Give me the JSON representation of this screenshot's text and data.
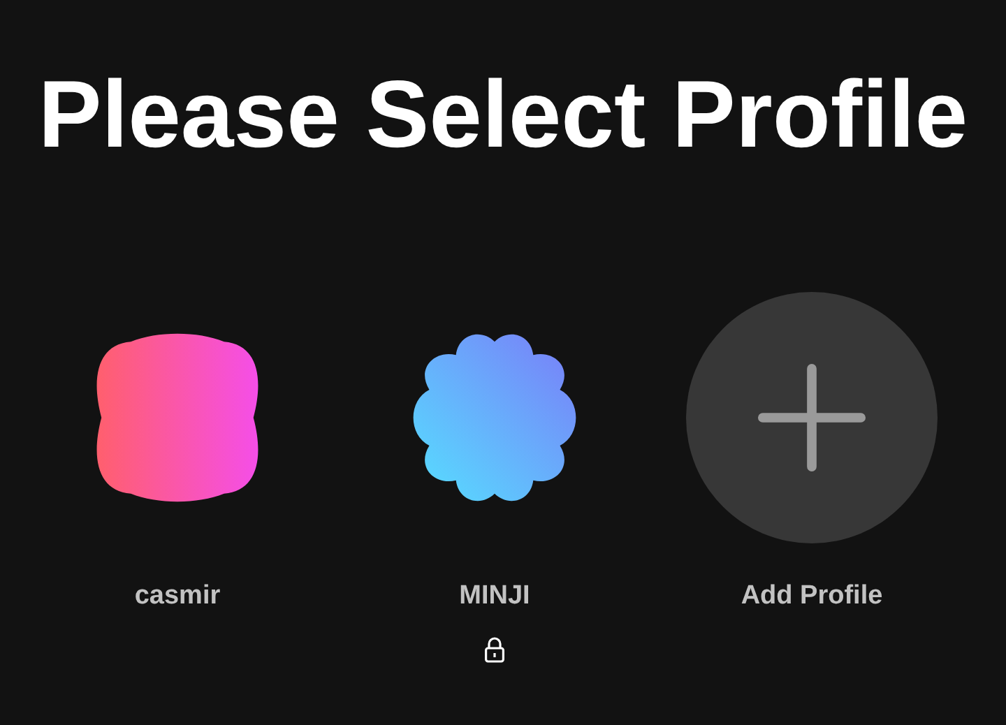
{
  "title": "Please Select Profile",
  "profiles": [
    {
      "kind": "blob",
      "name": "casmir",
      "locked": false
    },
    {
      "kind": "flower",
      "name": "MINJI",
      "locked": true
    },
    {
      "kind": "add",
      "name": "Add Profile",
      "locked": false
    }
  ]
}
